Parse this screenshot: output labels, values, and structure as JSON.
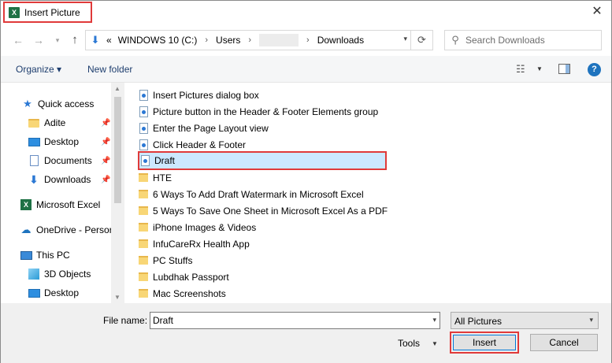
{
  "window": {
    "title": "Insert Picture",
    "app_icon_letter": "X",
    "close_glyph": "✕"
  },
  "nav": {
    "back_glyph": "←",
    "forward_glyph": "→",
    "recent_glyph": "▾",
    "up_glyph": "↑",
    "address": {
      "prefix": "«",
      "crumbs": [
        "WINDOWS 10 (C:)",
        "Users",
        "",
        "Downloads"
      ],
      "separator": "›"
    },
    "refresh_glyph": "⟳",
    "search_placeholder": "Search Downloads"
  },
  "toolbar": {
    "organize_label": "Organize ▾",
    "new_folder_label": "New folder",
    "help_label": "?"
  },
  "navpane": {
    "items": [
      {
        "label": "Quick access",
        "icon": "star-icon"
      },
      {
        "label": "Adite",
        "icon": "folder-icon",
        "pinned": true
      },
      {
        "label": "Desktop",
        "icon": "desktop-icon",
        "pinned": true
      },
      {
        "label": "Documents",
        "icon": "documents-icon",
        "pinned": true
      },
      {
        "label": "Downloads",
        "icon": "download-icon",
        "pinned": true
      },
      {
        "label": "Microsoft Excel",
        "icon": "excel-icon"
      },
      {
        "label": "OneDrive - Persor",
        "icon": "cloud-icon"
      },
      {
        "label": "This PC",
        "icon": "computer-icon"
      },
      {
        "label": "3D Objects",
        "icon": "3d-objects-icon"
      },
      {
        "label": "Desktop",
        "icon": "desktop-icon"
      }
    ]
  },
  "files": [
    {
      "name": "Insert Pictures dialog box",
      "type": "image"
    },
    {
      "name": "Picture button in the Header & Footer Elements group",
      "type": "image"
    },
    {
      "name": "Enter the Page Layout view",
      "type": "image"
    },
    {
      "name": "Click Header & Footer",
      "type": "image"
    },
    {
      "name": "Draft",
      "type": "image",
      "selected": true
    },
    {
      "name": "HTE",
      "type": "folder"
    },
    {
      "name": "6 Ways To Add Draft Watermark in Microsoft Excel",
      "type": "folder"
    },
    {
      "name": "5 Ways To Save One Sheet in Microsoft Excel As a PDF",
      "type": "folder"
    },
    {
      "name": "iPhone Images & Videos",
      "type": "folder"
    },
    {
      "name": "InfuCareRx Health App",
      "type": "folder"
    },
    {
      "name": "PC Stuffs",
      "type": "folder"
    },
    {
      "name": "Lubdhak Passport",
      "type": "folder"
    },
    {
      "name": "Mac Screenshots",
      "type": "folder"
    }
  ],
  "bottom": {
    "file_name_label": "File name:",
    "file_name_value": "Draft",
    "file_type_value": "All Pictures",
    "tools_label": "Tools",
    "insert_label": "Insert",
    "cancel_label": "Cancel"
  },
  "colors": {
    "highlight_border": "#e03a3a",
    "selection_fill": "#cce8ff",
    "accent": "#0078d7"
  }
}
